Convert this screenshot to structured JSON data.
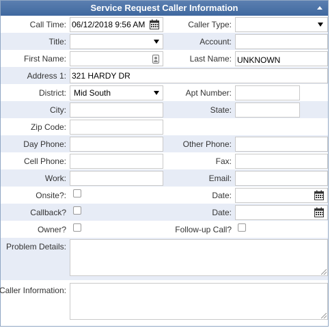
{
  "header": {
    "title": "Service Request Caller Information"
  },
  "fields": {
    "call_time_label": "Call Time:",
    "call_time_value": "06/12/2018 9:56 AM",
    "caller_type_label": "Caller Type:",
    "caller_type_value": "",
    "title_label": "Title:",
    "title_value": "",
    "account_label": "Account:",
    "account_value": "",
    "first_name_label": "First Name:",
    "first_name_value": "",
    "last_name_label": "Last Name:",
    "last_name_value": "UNKNOWN",
    "address1_label": "Address 1:",
    "address1_value": "321 HARDY DR",
    "district_label": "District:",
    "district_value": "Mid South",
    "apt_number_label": "Apt Number:",
    "apt_number_value": "",
    "city_label": "City:",
    "city_value": "",
    "state_label": "State:",
    "state_value": "",
    "zip_label": "Zip Code:",
    "zip_value": "",
    "day_phone_label": "Day Phone:",
    "day_phone_value": "",
    "other_phone_label": "Other Phone:",
    "other_phone_value": "",
    "cell_phone_label": "Cell Phone:",
    "cell_phone_value": "",
    "fax_label": "Fax:",
    "fax_value": "",
    "work_label": "Work:",
    "work_value": "",
    "email_label": "Email:",
    "email_value": "",
    "onsite_label": "Onsite?:",
    "onsite_checked": false,
    "onsite_date_label": "Date:",
    "onsite_date_value": "",
    "callback_label": "Callback?",
    "callback_checked": false,
    "callback_date_label": "Date:",
    "callback_date_value": "",
    "owner_label": "Owner?",
    "owner_checked": false,
    "followup_label": "Follow-up Call?",
    "followup_checked": false,
    "problem_details_label": "Problem Details:",
    "problem_details_value": "",
    "caller_information_label": "Caller Information:",
    "caller_information_value": ""
  },
  "icons": {
    "collapse": "chevron-up-icon",
    "calendar": "calendar-icon",
    "contact": "contact-card-icon",
    "dropdown": "caret-down-icon"
  },
  "colors": {
    "header_bg": "#4a72a8",
    "alt_row_bg": "#e7ecf6",
    "border": "#8fa6c3"
  }
}
